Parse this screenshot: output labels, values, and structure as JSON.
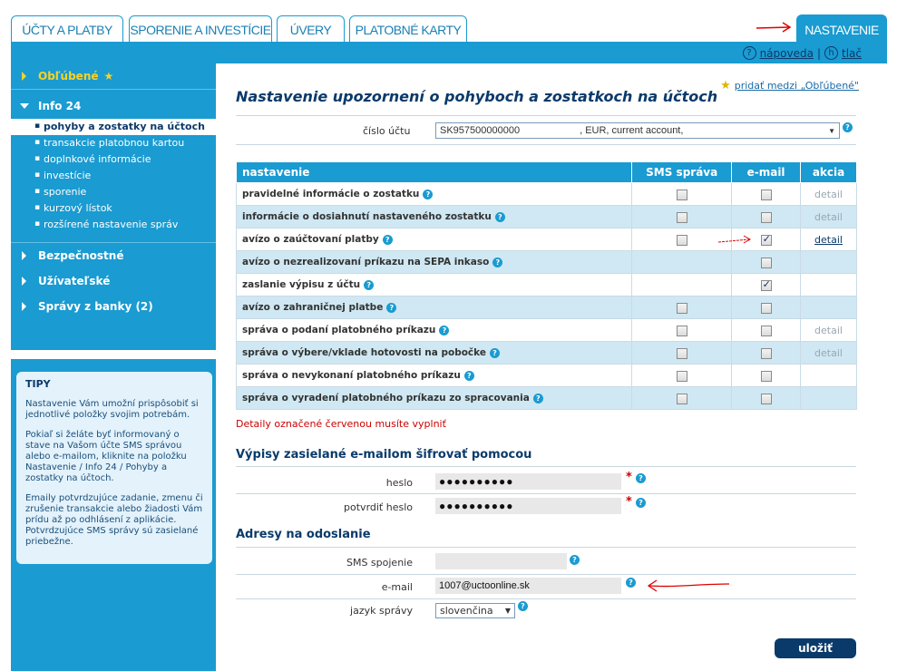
{
  "tabs": [
    {
      "label": "ÚČTY A PLATBY"
    },
    {
      "label": "SPORENIE A INVESTÍCIE"
    },
    {
      "label": "ÚVERY"
    },
    {
      "label": "PLATOBNÉ KARTY"
    },
    {
      "label": "NASTAVENIE",
      "active": true
    }
  ],
  "helpbar": {
    "help_icon": "?",
    "help": "nápoveda",
    "sep": "|",
    "print_icon": "h",
    "print": "tlač"
  },
  "sidebar": {
    "favorites": "Obľúbené",
    "favorites_star": "★",
    "info24": "Info 24",
    "info24_items": [
      {
        "label": "pohyby a zostatky na účtoch",
        "active": true
      },
      {
        "label": "transakcie platobnou kartou"
      },
      {
        "label": "doplnkové informácie"
      },
      {
        "label": "investície"
      },
      {
        "label": "sporenie"
      },
      {
        "label": "kurzový lístok"
      },
      {
        "label": "rozšírené nastavenie správ"
      }
    ],
    "sections": [
      "Bezpečnostné",
      "Užívateľské",
      "Správy z banky (2)"
    ]
  },
  "tips": {
    "title": "TIPY",
    "p1": "Nastavenie Vám umožní prispôsobiť si jednotlivé položky svojim potrebám.",
    "p2": "Pokiaľ si želáte byť informovaný o stave na Vašom účte SMS správou alebo e-mailom, kliknite na položku Nastavenie / Info 24 / Pohyby a zostatky na účtoch.",
    "p3": "Emaily potvrdzujúce zadanie, zmenu či zrušenie transakcie alebo žiadosti Vám prídu až po odhlásení z aplikácie. Potvrdzujúce SMS správy sú zasielané priebežne."
  },
  "main": {
    "fav_link": "pridať medzi „Obľúbené\"",
    "fav_star": "★",
    "title": "Nastavenie upozornení o pohyboch a zostatkoch na účtoch",
    "account_label": "číslo účtu",
    "account_number": "SK957500000000",
    "account_rest": ", EUR, current account,",
    "help_q": "?",
    "table": {
      "headers": [
        "nastavenie",
        "SMS správa",
        "e-mail",
        "akcia"
      ],
      "rows": [
        {
          "name": "pravidelné informácie o zostatku",
          "sms": false,
          "sms_shown": true,
          "email": false,
          "email_shown": true,
          "action": "detail",
          "action_active": false
        },
        {
          "name": "informácie o dosiahnutí nastaveného zostatku",
          "sms": false,
          "sms_shown": true,
          "email": false,
          "email_shown": true,
          "action": "detail",
          "action_active": false
        },
        {
          "name": "avízo o zaúčtovaní platby",
          "sms": false,
          "sms_shown": true,
          "email": true,
          "email_shown": true,
          "action": "detail",
          "action_active": true
        },
        {
          "name": "avízo o nezrealizovaní príkazu na SEPA inkaso",
          "sms": false,
          "sms_shown": false,
          "email": false,
          "email_shown": true,
          "action": "",
          "action_active": false
        },
        {
          "name": "zaslanie výpisu z účtu",
          "sms": false,
          "sms_shown": false,
          "email": true,
          "email_shown": true,
          "action": "",
          "action_active": false
        },
        {
          "name": "avízo o zahraničnej platbe",
          "sms": false,
          "sms_shown": true,
          "email": false,
          "email_shown": true,
          "action": "",
          "action_active": false
        },
        {
          "name": "správa o podaní platobného príkazu",
          "sms": false,
          "sms_shown": true,
          "email": false,
          "email_shown": true,
          "action": "detail",
          "action_active": false
        },
        {
          "name": "správa o výbere/vklade hotovosti na pobočke",
          "sms": false,
          "sms_shown": true,
          "email": false,
          "email_shown": true,
          "action": "detail",
          "action_active": false
        },
        {
          "name": "správa o nevykonaní platobného príkazu",
          "sms": false,
          "sms_shown": true,
          "email": false,
          "email_shown": true,
          "action": "",
          "action_active": false
        },
        {
          "name": "správa o vyradení platobného príkazu zo spracovania",
          "sms": false,
          "sms_shown": true,
          "email": false,
          "email_shown": true,
          "action": "",
          "action_active": false
        }
      ]
    },
    "required_note": "Detaily označené červenou musíte vyplniť",
    "encrypt_heading": "Výpisy zasielané e-mailom šifrovať pomocou",
    "password_label": "heslo",
    "password_value": "●●●●●●●●●●",
    "confirm_label": "potvrdiť heslo",
    "confirm_value": "●●●●●●●●●●",
    "required_mark": "*",
    "address_heading": "Adresy na odoslanie",
    "sms_label": "SMS spojenie",
    "sms_value": "",
    "email_label": "e-mail",
    "email_value": "1007@uctoonline.sk",
    "lang_label": "jazyk správy",
    "lang_value": "slovenčina",
    "save": "uložiť"
  },
  "colors": {
    "brand": "#1a9bd1",
    "dark": "#0a3a6a",
    "alt_row": "#cfe8f3",
    "required": "#cc0000",
    "annotation": "#e00000"
  }
}
